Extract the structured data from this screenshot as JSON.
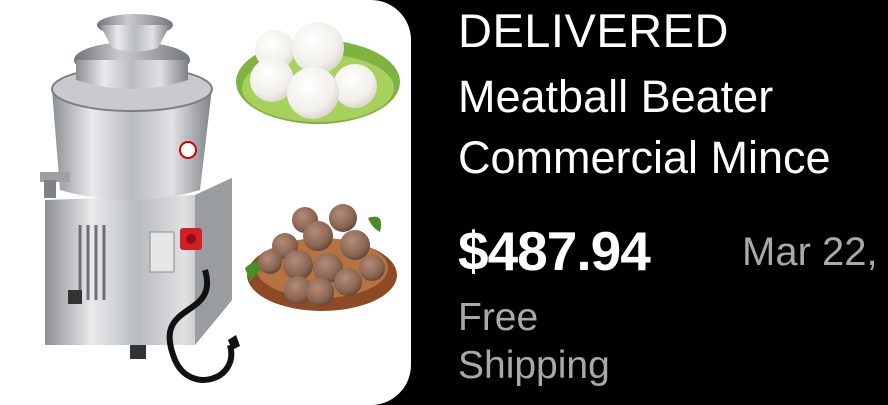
{
  "order_card": {
    "status": "DELIVERED",
    "title_lines": [
      "Meatball Beater",
      "Commercial Mince"
    ],
    "price": "$487.94",
    "date": "Mar 22,",
    "shipping_lines": [
      "Free",
      "Shipping"
    ],
    "image": {
      "depicts": [
        "meatball-beater-machine",
        "white-fishballs-plate",
        "beef-meatballs-plate"
      ]
    }
  },
  "colors": {
    "background": "#000000",
    "primary_text": "#ffffff",
    "secondary_text": "#a9a9a9",
    "thumbnail_bg": "#ffffff"
  }
}
